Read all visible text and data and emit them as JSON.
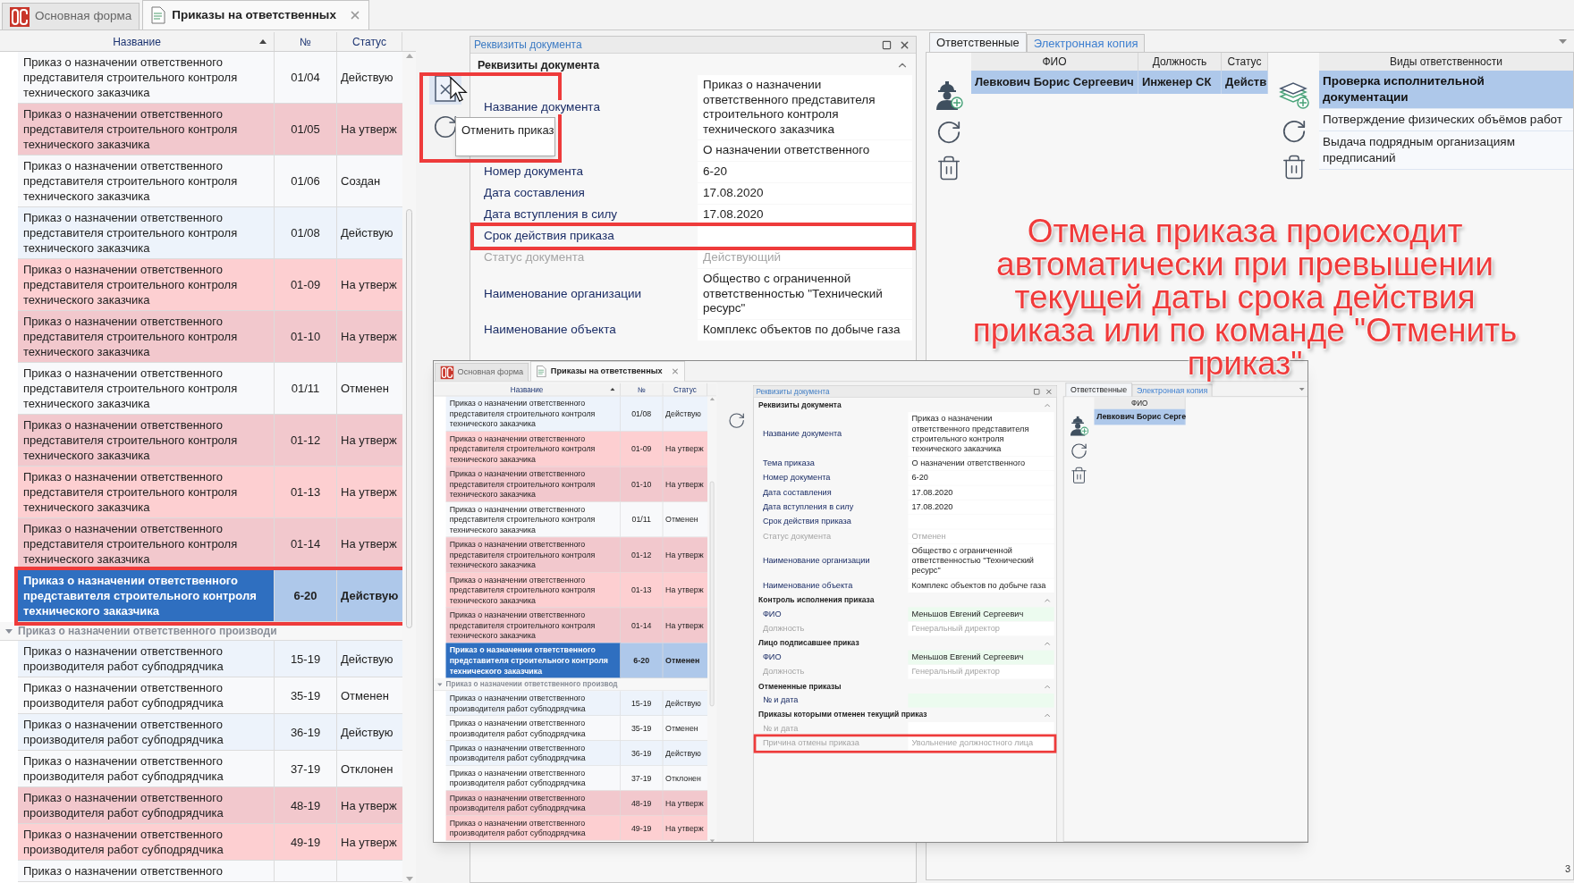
{
  "tabs": [
    {
      "label": "Основная форма",
      "selected": false,
      "closable": false
    },
    {
      "label": "Приказы на ответственных",
      "selected": true,
      "closable": true
    }
  ],
  "orders": {
    "columns": [
      {
        "label": "Название",
        "sorted": true
      },
      {
        "label": "№",
        "sorted": false
      },
      {
        "label": "Статус",
        "sorted": false
      }
    ],
    "groups": [
      {
        "rows": [
          {
            "name": "Приказ о назначении ответственного представителя строительного контроля технического заказчика",
            "number": "01/04",
            "status": "Действую",
            "color": "#f8f9fb",
            "selected": false,
            "highlighted": false
          },
          {
            "name": "Приказ о назначении ответственного представителя строительного контроля технического заказчика",
            "number": "01/05",
            "status": "На утверж",
            "color": "#f2c8cd",
            "selected": false,
            "highlighted": false
          },
          {
            "name": "Приказ о назначении ответственного представителя строительного контроля технического заказчика",
            "number": "01/06",
            "status": "Создан",
            "color": "#f8f9fb",
            "selected": false,
            "highlighted": false
          },
          {
            "name": "Приказ о назначении ответственного представителя строительного контроля технического заказчика",
            "number": "01/08",
            "status": "Действую",
            "color": "#edf3fb",
            "selected": false,
            "highlighted": false
          },
          {
            "name": "Приказ о назначении ответственного представителя строительного контроля технического заказчика",
            "number": "01-09",
            "status": "На утверж",
            "color": "#fdcfd1",
            "selected": false,
            "highlighted": false
          },
          {
            "name": "Приказ о назначении ответственного представителя строительного контроля технического заказчика",
            "number": "01-10",
            "status": "На утверж",
            "color": "#f2c8cd",
            "selected": false,
            "highlighted": false
          },
          {
            "name": "Приказ о назначении ответственного представителя строительного контроля технического заказчика",
            "number": "01/11",
            "status": "Отменен",
            "color": "#f8f9fb",
            "selected": false,
            "highlighted": false
          },
          {
            "name": "Приказ о назначении ответственного представителя строительного контроля технического заказчика",
            "number": "01-12",
            "status": "На утверж",
            "color": "#f2c8cd",
            "selected": false,
            "highlighted": false
          },
          {
            "name": "Приказ о назначении ответственного представителя строительного контроля технического заказчика",
            "number": "01-13",
            "status": "На утверж",
            "color": "#fdcfd1",
            "selected": false,
            "highlighted": false
          },
          {
            "name": "Приказ о назначении ответственного представителя строительного контроля технического заказчика",
            "number": "01-14",
            "status": "На утверж",
            "color": "#f2c8cd",
            "selected": false,
            "highlighted": false
          },
          {
            "name": "Приказ о назначении ответственного представителя строительного контроля технического заказчика",
            "number": "6-20",
            "status": "Действую",
            "selected": true,
            "highlighted": true
          }
        ]
      },
      {
        "title": "Приказ о назначении ответственного производи",
        "expanded": true,
        "rows": [
          {
            "name": "Приказ о назначении ответственного производителя работ субподрядчика",
            "number": "15-19",
            "status": "Действую",
            "color": "#edf3fb",
            "selected": false,
            "highlighted": false
          },
          {
            "name": "Приказ о назначении ответственного производителя работ субподрядчика",
            "number": "35-19",
            "status": "Отменен",
            "color": "#f8f9fb",
            "selected": false,
            "highlighted": false
          },
          {
            "name": "Приказ о назначении ответственного производителя работ субподрядчика",
            "number": "36-19",
            "status": "Действую",
            "color": "#edf3fb",
            "selected": false,
            "highlighted": false
          },
          {
            "name": "Приказ о назначении ответственного производителя работ субподрядчика",
            "number": "37-19",
            "status": "Отклонен",
            "color": "#f8f9fb",
            "selected": false,
            "highlighted": false
          },
          {
            "name": "Приказ о назначении ответственного производителя работ субподрядчика",
            "number": "48-19",
            "status": "На утверж",
            "color": "#f2c8cd",
            "selected": false,
            "highlighted": false
          },
          {
            "name": "Приказ о назначении ответственного производителя работ субподрядчика",
            "number": "49-19",
            "status": "На утверж",
            "color": "#fdcfd1",
            "selected": false,
            "highlighted": false
          },
          {
            "name": "Приказ о назначении ответственного",
            "color": "#f8f9fb",
            "selected": false,
            "highlighted": false
          }
        ]
      }
    ]
  },
  "toolbar": {
    "buttons": [
      {
        "kind": "cancel",
        "highlighted": true
      },
      {
        "kind": "refresh",
        "highlighted": false
      }
    ],
    "tooltip": "Отменить приказ"
  },
  "document": {
    "title": "Реквизиты документа",
    "sections": [
      {
        "title": "Реквизиты документа",
        "expanded": true,
        "fields": [
          {
            "label": "Название документа",
            "value": "Приказ о назначении ответственного представителя строительного контроля технического заказчика",
            "disabled": false,
            "highlighted": false
          },
          {
            "value": "О назначении ответственного",
            "disabled": false,
            "highlighted": false
          },
          {
            "label": "Номер документа",
            "value": "6-20",
            "disabled": false,
            "highlighted": false
          },
          {
            "label": "Дата составления",
            "value": "17.08.2020",
            "disabled": false,
            "highlighted": false
          },
          {
            "label": "Дата вступления в силу",
            "value": "17.08.2020",
            "disabled": false,
            "highlighted": false
          },
          {
            "label": "Срок действия приказа",
            "disabled": false,
            "highlighted": true
          },
          {
            "label": "Статус документа",
            "value": "Действующий",
            "disabled": true,
            "highlighted": false
          },
          {
            "label": "Наименование организации",
            "value": "Общество с ограниченной ответственностью \"Технический ресурс\"",
            "disabled": false,
            "highlighted": false
          },
          {
            "label": "Наименование объекта",
            "value": "Комплекс объектов по добыче газа",
            "disabled": false,
            "highlighted": false
          }
        ]
      }
    ]
  },
  "responsible": {
    "tabs": [
      {
        "label": "Ответственные",
        "selected": true
      },
      {
        "label": "Электронная копия",
        "selected": false
      }
    ],
    "people": {
      "columns": [
        {
          "label": "ФИО",
          "kind": "fio"
        },
        {
          "label": "Должность",
          "kind": "position"
        },
        {
          "label": "Статус",
          "kind": "status"
        }
      ],
      "rows": [
        {
          "cells": [
            "Левкович Борис Сергеевич",
            "Инженер СК",
            "Действ"
          ],
          "selected": true
        }
      ]
    },
    "duties": {
      "title": "Виды ответственности",
      "rows": [
        {
          "text": "Проверка исполнительной документации",
          "selected": true
        },
        {
          "text": "Потверждение физических объёмов работ",
          "selected": false
        },
        {
          "text": "Выдача подрядным организациям предписаний",
          "selected": false
        }
      ]
    }
  },
  "annotation": [
    "Отмена приказа происходит",
    "автоматически при превышении",
    "текущей даты срока действия",
    "приказа или по команде \"Отменить",
    "приказ\""
  ],
  "page_number": "3",
  "inset": {
    "tabs": [
      {
        "label": "Основная форма",
        "selected": false,
        "closable": false
      },
      {
        "label": "Приказы на ответственных",
        "selected": true,
        "closable": true
      }
    ],
    "orders": {
      "columns": [
        {
          "label": "Название",
          "sorted": true
        },
        {
          "label": "№",
          "sorted": false
        },
        {
          "label": "Статус",
          "sorted": false
        }
      ],
      "groups": [
        {
          "rows": [
            {
              "name": "Приказ о назначении ответственного представителя строительного контроля технического заказчика",
              "number": "01/08",
              "status": "Действую",
              "color": "#edf3fb",
              "selected": false,
              "highlighted": false
            },
            {
              "name": "Приказ о назначении ответственного представителя строительного контроля технического заказчика",
              "number": "01-09",
              "status": "На утверж",
              "color": "#fdcfd1",
              "selected": false,
              "highlighted": false
            },
            {
              "name": "Приказ о назначении ответственного представителя строительного контроля технического заказчика",
              "number": "01-10",
              "status": "На утверж",
              "color": "#f2c8cd",
              "selected": false,
              "highlighted": false
            },
            {
              "name": "Приказ о назначении ответственного представителя строительного контроля технического заказчика",
              "number": "01/11",
              "status": "Отменен",
              "color": "#f8f9fb",
              "selected": false,
              "highlighted": false
            },
            {
              "name": "Приказ о назначении ответственного представителя строительного контроля технического заказчика",
              "number": "01-12",
              "status": "На утверж",
              "color": "#f2c8cd",
              "selected": false,
              "highlighted": false
            },
            {
              "name": "Приказ о назначении ответственного представителя строительного контроля технического заказчика",
              "number": "01-13",
              "status": "На утверж",
              "color": "#fdcfd1",
              "selected": false,
              "highlighted": false
            },
            {
              "name": "Приказ о назначении ответственного представителя строительного контроля технического заказчика",
              "number": "01-14",
              "status": "На утверж",
              "color": "#f2c8cd",
              "selected": false,
              "highlighted": false
            },
            {
              "name": "Приказ о назначении ответственного представителя строительного контроля технического заказчика",
              "number": "6-20",
              "status": "Отменен",
              "selected": true,
              "highlighted": false
            }
          ]
        },
        {
          "title": "Приказ о назначении ответственного производ",
          "expanded": true,
          "rows": [
            {
              "name": "Приказ о назначении ответственного производителя работ субподрядчика",
              "number": "15-19",
              "status": "Действую",
              "color": "#edf3fb",
              "selected": false,
              "highlighted": false
            },
            {
              "name": "Приказ о назначении ответственного производителя работ субподрядчика",
              "number": "35-19",
              "status": "Отменен",
              "color": "#f8f9fb",
              "selected": false,
              "highlighted": false
            },
            {
              "name": "Приказ о назначении ответственного производителя работ субподрядчика",
              "number": "36-19",
              "status": "Действую",
              "color": "#edf3fb",
              "selected": false,
              "highlighted": false
            },
            {
              "name": "Приказ о назначении ответственного производителя работ субподрядчика",
              "number": "37-19",
              "status": "Отклонен",
              "color": "#f8f9fb",
              "selected": false,
              "highlighted": false
            },
            {
              "name": "Приказ о назначении ответственного производителя работ субподрядчика",
              "number": "48-19",
              "status": "На утверж",
              "color": "#f2c8cd",
              "selected": false,
              "highlighted": false
            },
            {
              "name": "Приказ о назначении ответственного производителя работ субподрядчика",
              "number": "49-19",
              "status": "На утверж",
              "color": "#fdcfd1",
              "selected": false,
              "highlighted": false
            }
          ]
        }
      ]
    },
    "toolbar": {
      "buttons": [
        {
          "kind": "refresh",
          "highlighted": false
        }
      ]
    },
    "document": {
      "title": "Реквизиты документа",
      "sections": [
        {
          "title": "Реквизиты документа",
          "expanded": true,
          "fields": [
            {
              "label": "Название документа",
              "value": "Приказ о назначении ответственного представителя строительного контроля технического заказчика",
              "disabled": false,
              "highlighted": false,
              "required": false
            },
            {
              "label": "Тема приказа",
              "value": "О назначении ответственного",
              "disabled": false,
              "highlighted": false,
              "required": false
            },
            {
              "label": "Номер документа",
              "value": "6-20",
              "disabled": false,
              "highlighted": false,
              "required": false
            },
            {
              "label": "Дата составления",
              "value": "17.08.2020",
              "disabled": false,
              "highlighted": false,
              "required": false
            },
            {
              "label": "Дата вступления в силу",
              "value": "17.08.2020",
              "disabled": false,
              "highlighted": false,
              "required": false
            },
            {
              "label": "Срок действия приказа",
              "disabled": false,
              "highlighted": false,
              "required": false
            },
            {
              "label": "Статус документа",
              "value": "Отменен",
              "disabled": true,
              "highlighted": false,
              "required": false
            },
            {
              "label": "Наименование организации",
              "value": "Общество с ограниченной ответственностью \"Технический ресурс\"",
              "disabled": false,
              "highlighted": false,
              "required": false
            },
            {
              "label": "Наименование объекта",
              "value": "Комплекс объектов по добыче газа",
              "disabled": false,
              "highlighted": false,
              "required": false
            }
          ]
        },
        {
          "title": "Контроль исполнения приказа",
          "expanded": true,
          "fields": [
            {
              "label": "ФИО",
              "value": "Меньшов Евгений Сергеевич",
              "disabled": false,
              "highlighted": false,
              "required": true
            },
            {
              "label": "Должность",
              "value": "Генеральный директор",
              "disabled": true,
              "highlighted": false,
              "required": false
            }
          ]
        },
        {
          "title": "Лицо подписавшее приказ",
          "expanded": true,
          "fields": [
            {
              "label": "ФИО",
              "value": "Меньшов Евгений Сергеевич",
              "disabled": false,
              "highlighted": false,
              "required": true
            },
            {
              "label": "Должность",
              "value": "Генеральный директор",
              "disabled": true,
              "highlighted": false,
              "required": false
            }
          ]
        },
        {
          "title": "Отмененные приказы",
          "expanded": true,
          "fields": [
            {
              "label": "№ и дата",
              "disabled": false,
              "highlighted": false,
              "required": true
            }
          ]
        },
        {
          "title": "Приказы которыми отменен текущий приказ",
          "expanded": true,
          "fields": [
            {
              "label": "№ и дата",
              "disabled": true,
              "highlighted": false,
              "required": false
            },
            {
              "label": "Причина отмены приказа",
              "value": "Увольнение должностного лица",
              "disabled": true,
              "highlighted": true,
              "required": false
            }
          ]
        }
      ]
    },
    "responsible": {
      "tabs": [
        {
          "label": "Ответственные",
          "selected": true
        },
        {
          "label": "Электронная копия",
          "selected": false
        }
      ],
      "people": {
        "columns": [
          {
            "label": "ФИО",
            "kind": "fio"
          }
        ],
        "rows": [
          {
            "cells": [
              "Левкович Борис Серге"
            ],
            "selected": true
          }
        ]
      }
    }
  }
}
